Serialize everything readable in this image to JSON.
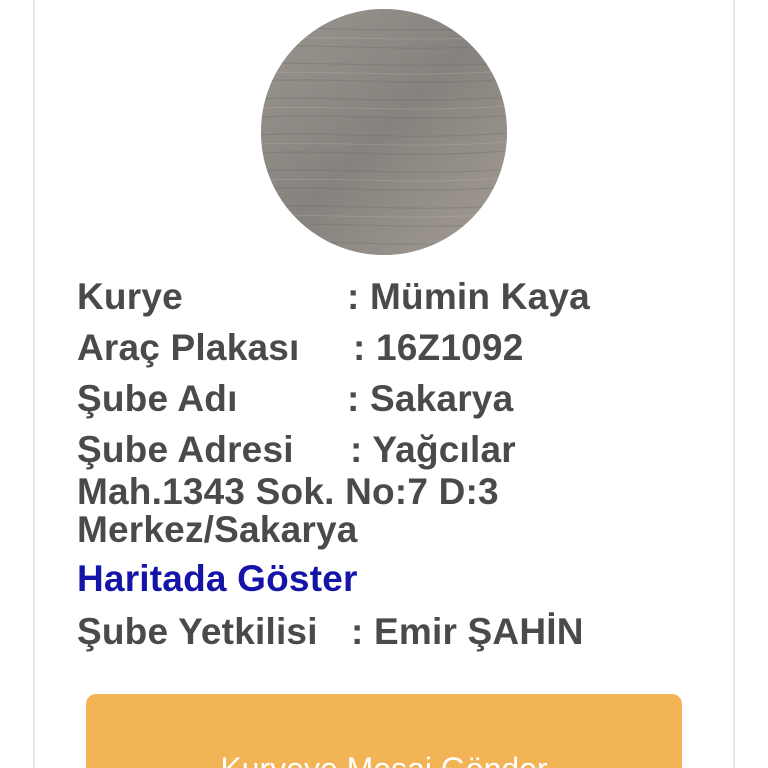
{
  "profile": {
    "photo_icon": "wood-texture-avatar",
    "photo_color": "#8d8a86"
  },
  "courier": {
    "label": "Kurye",
    "value": ": Mümin Kaya"
  },
  "plate": {
    "label": "Araç Plakası",
    "value": ": 16Z1092"
  },
  "branch_name": {
    "label": "Şube Adı",
    "value": ": Sakarya"
  },
  "branch_address": {
    "label": "Şube Adresi",
    "value_line1": ": Yağcılar",
    "value_line2": "Mah.1343 Sok. No:7 D:3",
    "value_line3": "Merkez/Sakarya"
  },
  "map_link": {
    "label": "Haritada Göster",
    "color": "#1414a8"
  },
  "branch_manager": {
    "label": "Şube Yetkilisi",
    "value": ": Emir ŞAHİN"
  },
  "send_button": {
    "label": "Kuryeye Mesaj Gönder",
    "color": "#f2b455"
  }
}
